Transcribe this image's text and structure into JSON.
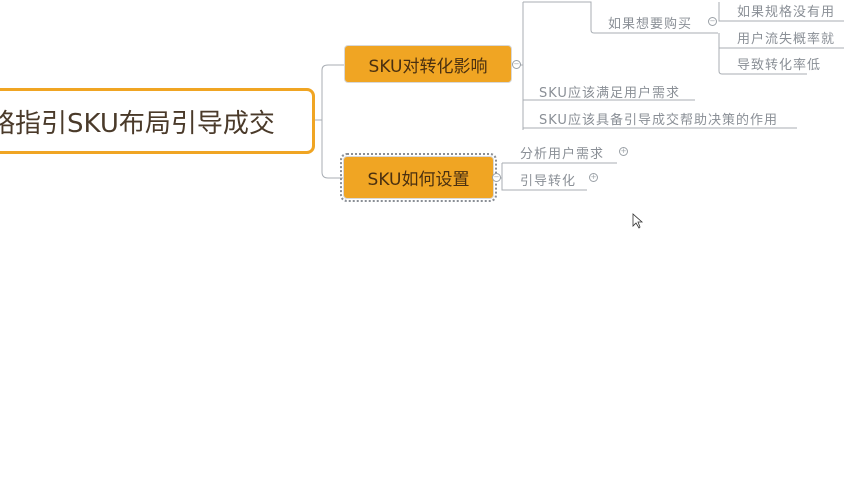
{
  "root": {
    "title": "略指引SKU布局引导成交"
  },
  "branches": [
    {
      "label": "SKU对转化影响",
      "children": [
        {
          "label": "如果想要购买",
          "children": [
            {
              "label": "如果规格没有用"
            },
            {
              "label": "用户流失概率就"
            },
            {
              "label": "导致转化率低"
            }
          ]
        },
        {
          "label": "SKU应该满足用户需求"
        },
        {
          "label": "SKU应该具备引导成交帮助决策的作用"
        }
      ]
    },
    {
      "label": "SKU如何设置",
      "children": [
        {
          "label": "分析用户需求"
        },
        {
          "label": "引导转化"
        }
      ]
    }
  ],
  "colors": {
    "accent": "#f0a523",
    "line": "#9aa0a6"
  }
}
